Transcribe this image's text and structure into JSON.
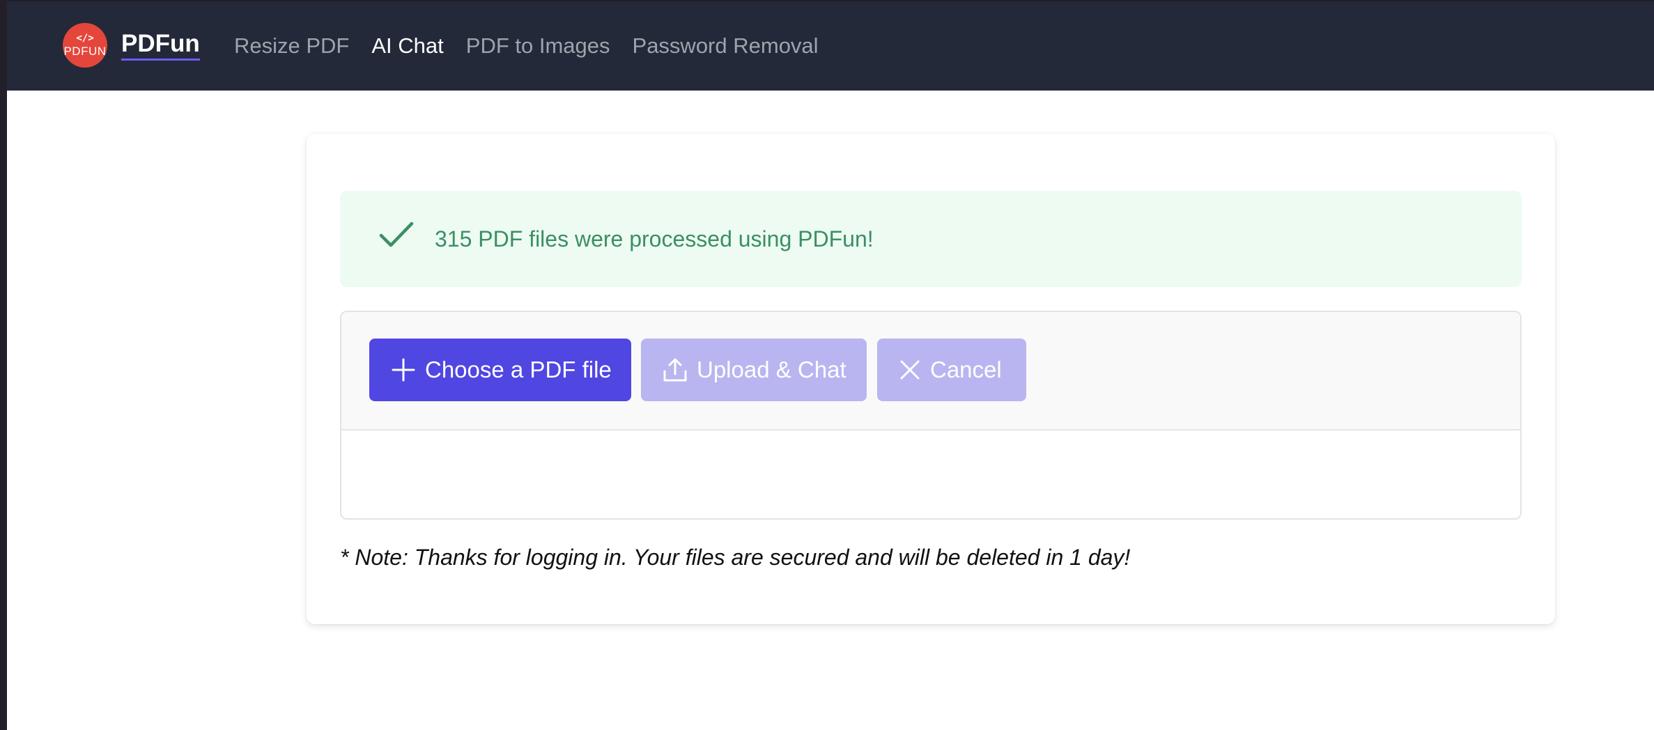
{
  "brand": {
    "name": "PDFun",
    "logo_code": "</>",
    "logo_word": "PDFUN"
  },
  "nav": {
    "links": [
      {
        "label": "Resize PDF",
        "active": false
      },
      {
        "label": "AI Chat",
        "active": true
      },
      {
        "label": "PDF to Images",
        "active": false
      },
      {
        "label": "Password Removal",
        "active": false
      }
    ]
  },
  "alert": {
    "icon": "check-icon",
    "text": "315 PDF files were processed using PDFun!"
  },
  "upload": {
    "choose_label": "Choose a PDF file",
    "upload_label": "Upload & Chat",
    "cancel_label": "Cancel"
  },
  "note": "* Note: Thanks for logging in. Your files are secured and will be deleted in 1 day!",
  "colors": {
    "navbar": "#232938",
    "primary": "#5046e2",
    "primary_disabled": "#b9b5f0",
    "success_bg": "#edfbf3",
    "success_text": "#3b8f63",
    "logo": "#e5463b"
  }
}
